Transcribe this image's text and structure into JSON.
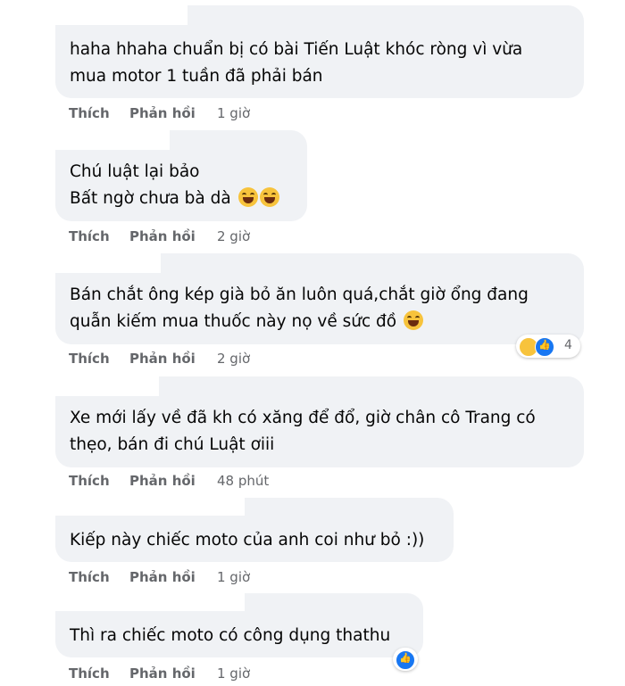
{
  "actions": {
    "like": "Thích",
    "reply": "Phản hồi"
  },
  "comments": [
    {
      "lines": [
        "haha hhaha chuẩn bị có bài Tiến Luật khóc ròng vì vừa",
        "mua motor 1 tuần đã phải bán"
      ],
      "time": "1 giờ"
    },
    {
      "lines": [
        "Chú luật lại bảo",
        "Bất ngờ chưa bà dà"
      ],
      "time": "2 giờ"
    },
    {
      "lines": [
        "Bán chắt ông kép già bỏ ăn luôn quá,chắt giờ ổng đang",
        "quẫn kiếm mua thuốc này nọ về sức đồ"
      ],
      "time": "2 giờ",
      "reaction_count": "4"
    },
    {
      "lines": [
        "Xe mới lấy về đã kh có xăng để đổ, giờ chân cô Trang có",
        "thẹo, bán đi chú Luật ơiii"
      ],
      "time": "48 phút"
    },
    {
      "lines": [
        "Kiếp này chiếc moto của anh coi như bỏ :))"
      ],
      "time": "1 giờ"
    },
    {
      "lines": [
        "Thì ra chiếc moto có công dụng thathu"
      ],
      "time": "1 giờ"
    }
  ],
  "colors": {
    "bubble": "#f0f2f5",
    "meta": "#65676b",
    "like": "#1877f2"
  }
}
